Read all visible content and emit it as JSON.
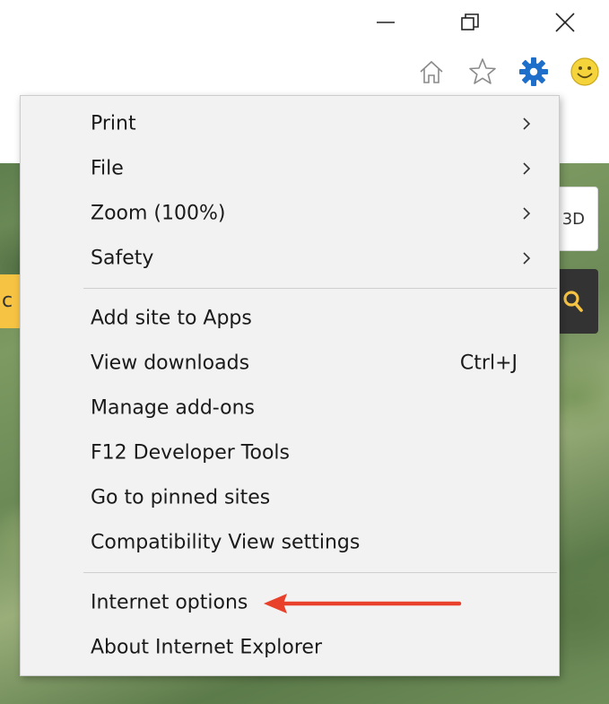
{
  "window": {
    "controls": {
      "minimize_icon": "minimize-icon",
      "restore_icon": "restore-icon",
      "close_icon": "close-icon"
    }
  },
  "command_bar": {
    "icons": [
      "home-icon",
      "star-icon",
      "gear-icon",
      "smiley-icon"
    ],
    "gear_color": "#1e6fc9",
    "smiley_color": "#f5d33b"
  },
  "page": {
    "search_box_text": "3D",
    "tab_text": "c",
    "search_icon_color": "#f6c343"
  },
  "menu": {
    "groups": [
      {
        "items": [
          {
            "label": "Print",
            "submenu": true
          },
          {
            "label": "File",
            "submenu": true
          },
          {
            "label": "Zoom (100%)",
            "submenu": true
          },
          {
            "label": "Safety",
            "submenu": true
          }
        ]
      },
      {
        "items": [
          {
            "label": "Add site to Apps"
          },
          {
            "label": "View downloads",
            "shortcut": "Ctrl+J"
          },
          {
            "label": "Manage add-ons"
          },
          {
            "label": "F12 Developer Tools"
          },
          {
            "label": "Go to pinned sites"
          },
          {
            "label": "Compatibility View settings"
          }
        ]
      },
      {
        "items": [
          {
            "label": "Internet options",
            "highlighted_by_annotation": true
          },
          {
            "label": "About Internet Explorer"
          }
        ]
      }
    ]
  },
  "annotation": {
    "color": "#e8402a",
    "points_to": "Internet options"
  }
}
